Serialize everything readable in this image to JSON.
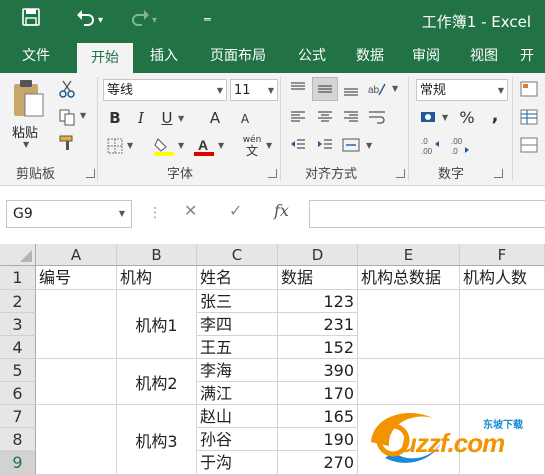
{
  "colors": {
    "accent": "#217346",
    "watermark_orange": "#f29400",
    "watermark_blue": "#1a8ad6"
  },
  "titlebar": {
    "title": "工作簿1 - Excel",
    "icons": [
      "save-icon",
      "undo-icon",
      "redo-icon",
      "customize-qat-icon"
    ]
  },
  "tabs": [
    "文件",
    "开始",
    "插入",
    "页面布局",
    "公式",
    "数据",
    "审阅",
    "视图",
    "开"
  ],
  "active_tab": "开始",
  "ribbon": {
    "clipboard": {
      "group_label": "剪贴板",
      "paste_label": "粘贴"
    },
    "font": {
      "group_label": "字体",
      "font_name": "等线",
      "font_size": "11",
      "bold": "B",
      "italic": "I",
      "underline": "U",
      "grow": "A",
      "shrink": "A",
      "phonetic": "wén"
    },
    "alignment": {
      "group_label": "对齐方式"
    },
    "number": {
      "group_label": "数字",
      "format": "常规",
      "percent": "%",
      "comma": ","
    }
  },
  "formula_bar": {
    "name_box": "G9",
    "cancel": "✕",
    "enter": "✓",
    "fx": "fx",
    "formula": ""
  },
  "grid": {
    "columns": [
      "A",
      "B",
      "C",
      "D",
      "E",
      "F"
    ],
    "rows": [
      "1",
      "2",
      "3",
      "4",
      "5",
      "6",
      "7",
      "8",
      "9"
    ],
    "selected_row": "9",
    "headers": [
      "编号",
      "机构",
      "姓名",
      "数据",
      "机构总数据",
      "机构人数"
    ],
    "institutions": [
      "机构1",
      "机构2",
      "机构3"
    ],
    "names": [
      "张三",
      "李四",
      "王五",
      "李海",
      "满江",
      "赵山",
      "孙谷",
      "于沟"
    ],
    "values": [
      "123",
      "231",
      "152",
      "390",
      "170",
      "165",
      "190",
      "270"
    ]
  },
  "watermark": {
    "brand": "uzzf.com",
    "tagline": "东坡下载"
  }
}
